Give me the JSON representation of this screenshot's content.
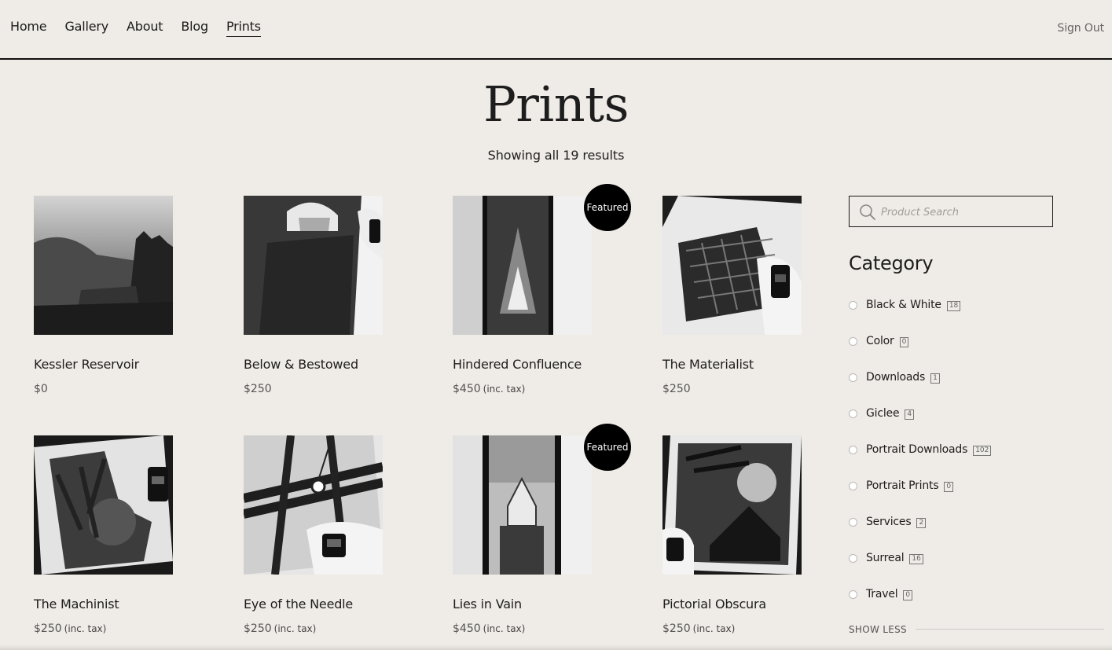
{
  "nav": {
    "items": [
      {
        "label": "Home"
      },
      {
        "label": "Gallery"
      },
      {
        "label": "About"
      },
      {
        "label": "Blog"
      },
      {
        "label": "Prints",
        "active": true
      }
    ],
    "signout_label": "Sign Out"
  },
  "page": {
    "title": "Prints",
    "results_text": "Showing all 19 results"
  },
  "products": [
    {
      "name": "Kessler Reservoir",
      "price": "$0",
      "tax": "",
      "featured": false
    },
    {
      "name": "Below & Bestowed",
      "price": "$250",
      "tax": "",
      "featured": false
    },
    {
      "name": "Hindered Confluence",
      "price": "$450",
      "tax": "(inc. tax)",
      "featured": true
    },
    {
      "name": "The Materialist",
      "price": "$250",
      "tax": "",
      "featured": false
    },
    {
      "name": "The Machinist",
      "price": "$250",
      "tax": "(inc. tax)",
      "featured": false
    },
    {
      "name": "Eye of the Needle",
      "price": "$250",
      "tax": "(inc. tax)",
      "featured": false
    },
    {
      "name": "Lies in Vain",
      "price": "$450",
      "tax": "(inc. tax)",
      "featured": true
    },
    {
      "name": "Pictorial Obscura",
      "price": "$250",
      "tax": "(inc. tax)",
      "featured": false
    }
  ],
  "badge_label": "Featured",
  "sidebar": {
    "search_placeholder": "Product Search",
    "category_heading": "Category",
    "categories": [
      {
        "label": "Black & White",
        "count": "18"
      },
      {
        "label": "Color",
        "count": "0"
      },
      {
        "label": "Downloads",
        "count": "1"
      },
      {
        "label": "Giclee",
        "count": "4"
      },
      {
        "label": "Portrait Downloads",
        "count": "102"
      },
      {
        "label": "Portrait Prints",
        "count": "0"
      },
      {
        "label": "Services",
        "count": "2"
      },
      {
        "label": "Surreal",
        "count": "16"
      },
      {
        "label": "Travel",
        "count": "0"
      }
    ],
    "show_less_label": "SHOW LESS"
  },
  "colors": {
    "background": "#efebe6",
    "text": "#1b1b1b",
    "badge": "#000000"
  }
}
